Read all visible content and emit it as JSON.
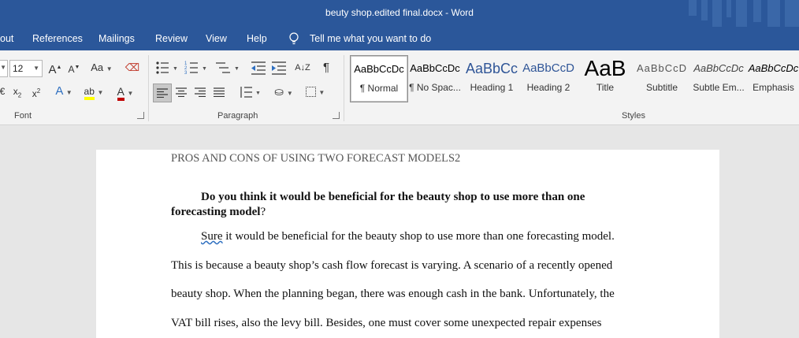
{
  "window": {
    "title": "beuty shop.edited final.docx  -  Word"
  },
  "menu": {
    "items": [
      "out",
      "References",
      "Mailings",
      "Review",
      "View",
      "Help"
    ],
    "tell_me": "Tell me what you want to do"
  },
  "ribbon": {
    "font": {
      "size": "12",
      "group_label": "Font",
      "case_label": "Aa"
    },
    "paragraph": {
      "group_label": "Paragraph"
    },
    "styles": {
      "group_label": "Styles",
      "items": [
        {
          "preview": "AaBbCcDc",
          "name": "¶ Normal"
        },
        {
          "preview": "AaBbCcDc",
          "name": "¶ No Spac..."
        },
        {
          "preview": "AaBbCc",
          "name": "Heading 1"
        },
        {
          "preview": "AaBbCcD",
          "name": "Heading 2"
        },
        {
          "preview": "AaB",
          "name": "Title"
        },
        {
          "preview": "AaBbCcD",
          "name": "Subtitle"
        },
        {
          "preview": "AaBbCcDc",
          "name": "Subtle Em..."
        },
        {
          "preview": "AaBbCcDc",
          "name": "Emphasis"
        }
      ]
    },
    "colors": {
      "accent": "#2b579a",
      "highlight": "#ffff00",
      "font_color": "#c00000"
    }
  },
  "document": {
    "header": "PROS AND CONS OF USING TWO FORECAST MODELS2",
    "question_line1": "Do you think it would be beneficial for the beauty shop to use more than one",
    "question_line2": "forecasting model",
    "question_mark": "?",
    "answer_first_word": "Sure",
    "answer_line1_rest": " it would be beneficial for the beauty shop to use more than one forecasting model.",
    "answer_line2": "This is because a beauty shop’s cash flow forecast is varying. A scenario of a recently opened",
    "answer_line3": "beauty shop. When the planning began, there was enough cash in the bank. Unfortunately, the",
    "answer_line4": "VAT bill rises, also the levy bill. Besides, one must cover some unexpected repair expenses"
  }
}
